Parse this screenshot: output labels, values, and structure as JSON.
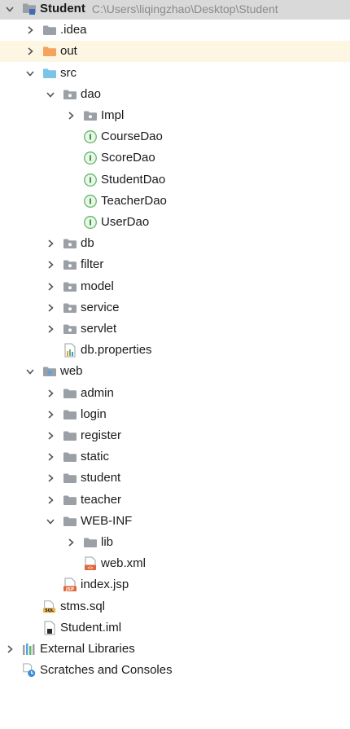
{
  "project": {
    "name": "Student",
    "path": "C:\\Users\\liqingzhao\\Desktop\\Student"
  },
  "colors": {
    "folder_gray": "#9aa0a6",
    "folder_orange": "#f5a25d",
    "folder_blue": "#7ac4e8",
    "interface_green": "#5fb865",
    "arrow": "#555555",
    "root_bg": "#d9d9d9",
    "selected_bg": "#fdf6e3"
  },
  "tree": [
    {
      "label": "Student",
      "path": "C:\\Users\\liqingzhao\\Desktop\\Student",
      "depth": 0,
      "expanded": true,
      "icon": "module-folder-icon"
    },
    {
      "label": ".idea",
      "depth": 1,
      "expanded": false,
      "icon": "folder-icon"
    },
    {
      "label": "out",
      "depth": 1,
      "expanded": false,
      "icon": "folder-excluded-icon",
      "highlighted": true
    },
    {
      "label": "src",
      "depth": 1,
      "expanded": true,
      "icon": "folder-source-icon"
    },
    {
      "label": "dao",
      "depth": 2,
      "expanded": true,
      "icon": "package-icon"
    },
    {
      "label": "Impl",
      "depth": 3,
      "expanded": false,
      "icon": "package-icon"
    },
    {
      "label": "CourseDao",
      "depth": 3,
      "icon": "interface-icon",
      "icon_letter": "I"
    },
    {
      "label": "ScoreDao",
      "depth": 3,
      "icon": "interface-icon",
      "icon_letter": "I"
    },
    {
      "label": "StudentDao",
      "depth": 3,
      "icon": "interface-icon",
      "icon_letter": "I"
    },
    {
      "label": "TeacherDao",
      "depth": 3,
      "icon": "interface-icon",
      "icon_letter": "I"
    },
    {
      "label": "UserDao",
      "depth": 3,
      "icon": "interface-icon",
      "icon_letter": "I"
    },
    {
      "label": "db",
      "depth": 2,
      "expanded": false,
      "icon": "package-icon"
    },
    {
      "label": "filter",
      "depth": 2,
      "expanded": false,
      "icon": "package-icon"
    },
    {
      "label": "model",
      "depth": 2,
      "expanded": false,
      "icon": "package-icon"
    },
    {
      "label": "service",
      "depth": 2,
      "expanded": false,
      "icon": "package-icon"
    },
    {
      "label": "servlet",
      "depth": 2,
      "expanded": false,
      "icon": "package-icon"
    },
    {
      "label": "db.properties",
      "depth": 2,
      "icon": "properties-file-icon"
    },
    {
      "label": "web",
      "depth": 1,
      "expanded": true,
      "icon": "web-folder-icon"
    },
    {
      "label": "admin",
      "depth": 2,
      "expanded": false,
      "icon": "folder-icon"
    },
    {
      "label": "login",
      "depth": 2,
      "expanded": false,
      "icon": "folder-icon"
    },
    {
      "label": "register",
      "depth": 2,
      "expanded": false,
      "icon": "folder-icon"
    },
    {
      "label": "static",
      "depth": 2,
      "expanded": false,
      "icon": "folder-icon"
    },
    {
      "label": "student",
      "depth": 2,
      "expanded": false,
      "icon": "folder-icon"
    },
    {
      "label": "teacher",
      "depth": 2,
      "expanded": false,
      "icon": "folder-icon"
    },
    {
      "label": "WEB-INF",
      "depth": 2,
      "expanded": true,
      "icon": "folder-icon"
    },
    {
      "label": "lib",
      "depth": 3,
      "expanded": false,
      "icon": "folder-icon"
    },
    {
      "label": "web.xml",
      "depth": 3,
      "icon": "xml-file-icon",
      "icon_badge": "<>"
    },
    {
      "label": "index.jsp",
      "depth": 2,
      "icon": "jsp-file-icon",
      "icon_badge": "JSP"
    },
    {
      "label": "stms.sql",
      "depth": 1,
      "icon": "sql-file-icon",
      "icon_badge": "SQL"
    },
    {
      "label": "Student.iml",
      "depth": 1,
      "icon": "iml-file-icon"
    },
    {
      "label": "External Libraries",
      "depth": 0,
      "expanded": false,
      "icon": "external-libraries-icon"
    },
    {
      "label": "Scratches and Consoles",
      "depth": 0,
      "icon": "scratches-icon"
    }
  ]
}
